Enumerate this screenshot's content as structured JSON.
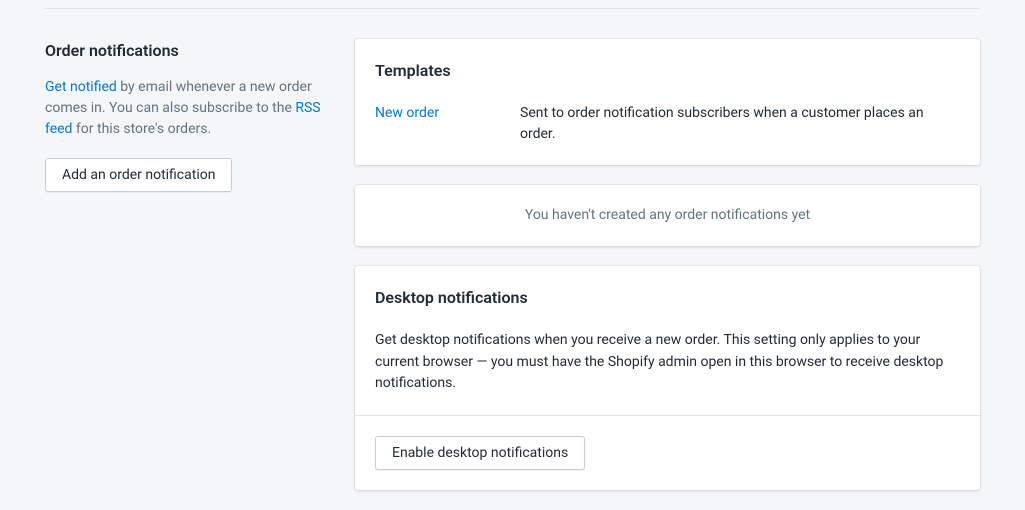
{
  "sidebar": {
    "heading": "Order notifications",
    "get_notified_link": "Get notified",
    "desc_part1": " by email whenever a new order comes in. You can also subscribe to the ",
    "rss_link": "RSS feed",
    "desc_part2": " for this store's orders.",
    "add_button": "Add an order notification"
  },
  "templates": {
    "heading": "Templates",
    "items": [
      {
        "name": "New order",
        "description": "Sent to order notification subscribers when a customer places an order."
      }
    ]
  },
  "empty_state": "You haven't created any order notifications yet",
  "desktop": {
    "heading": "Desktop notifications",
    "description": "Get desktop notifications when you receive a new order. This setting only applies to your current browser — you must have the Shopify admin open in this browser to receive desktop notifications.",
    "enable_button": "Enable desktop notifications"
  }
}
